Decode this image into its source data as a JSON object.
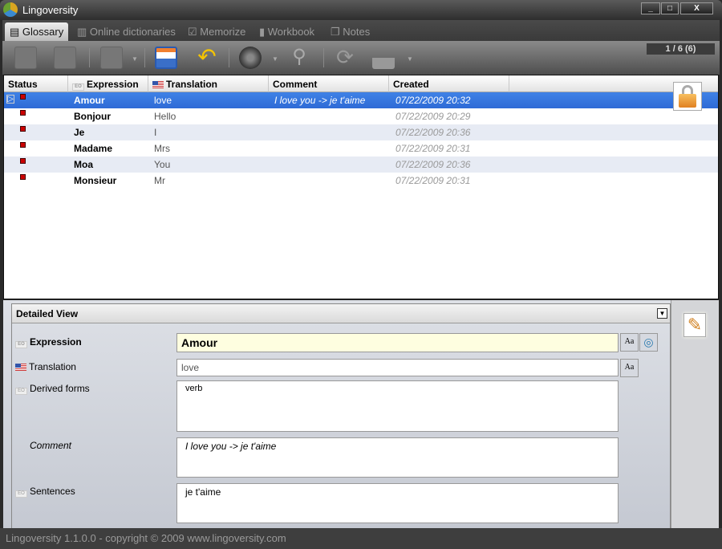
{
  "window": {
    "title": "Lingoversity",
    "minimize": "_",
    "maximize": "□",
    "close": "X"
  },
  "tabs": [
    {
      "label": "Glossary",
      "icon": "list-icon"
    },
    {
      "label": "Online dictionaries",
      "icon": "books-icon"
    },
    {
      "label": "Memorize",
      "icon": "checkbox-icon"
    },
    {
      "label": "Workbook",
      "icon": "workbook-icon"
    },
    {
      "label": "Notes",
      "icon": "notes-icon"
    }
  ],
  "toolbar": {
    "counter": "1 / 6 (6)"
  },
  "table": {
    "headers": [
      "Status",
      "Expression",
      "Translation",
      "Comment",
      "Created"
    ],
    "rows": [
      {
        "expression": "Amour",
        "translation": "love",
        "comment": "I love you -> je t'aime",
        "created": "07/22/2009 20:32"
      },
      {
        "expression": "Bonjour",
        "translation": "Hello",
        "comment": "",
        "created": "07/22/2009 20:29"
      },
      {
        "expression": "Je",
        "translation": "I",
        "comment": "",
        "created": "07/22/2009 20:36"
      },
      {
        "expression": "Madame",
        "translation": "Mrs",
        "comment": "",
        "created": "07/22/2009 20:31"
      },
      {
        "expression": "Moa",
        "translation": "You",
        "comment": "",
        "created": "07/22/2009 20:36"
      },
      {
        "expression": "Monsieur",
        "translation": "Mr",
        "comment": "",
        "created": "07/22/2009 20:31"
      }
    ]
  },
  "detail": {
    "title": "Detailed View",
    "expression_label": "Expression",
    "expression_value": "Amour",
    "translation_label": "Translation",
    "translation_value": "love",
    "derived_label": "Derived forms",
    "derived_value": "verb",
    "comment_label": "Comment",
    "comment_value": "I love you -> je t'aime",
    "sentences_label": "Sentences",
    "sentences_value": "je t'aime",
    "font_button": "Aa",
    "eo_tag": "EO"
  },
  "statusbar": "Lingoversity 1.1.0.0   -   copyright © 2009 www.lingoversity.com",
  "colors": {
    "selection": "#3a78e0",
    "accent": "#f0a030"
  }
}
